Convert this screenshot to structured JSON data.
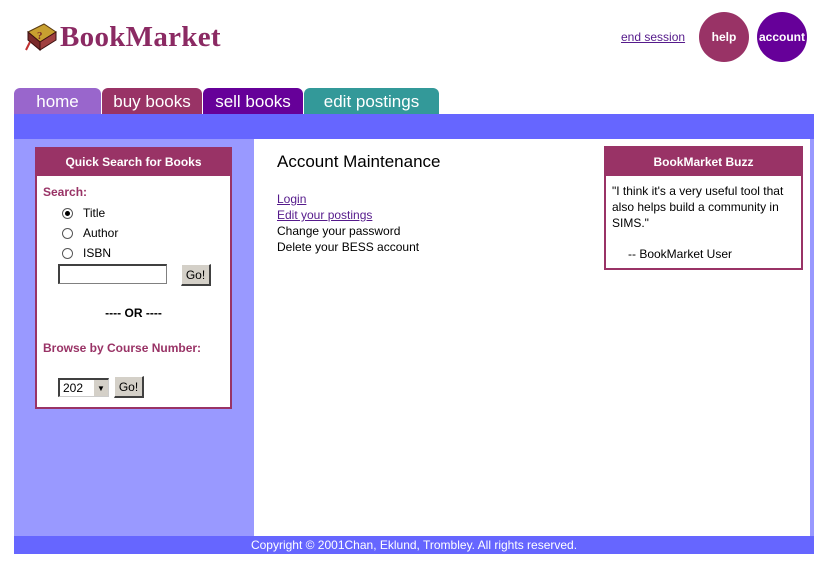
{
  "header": {
    "logo_text": "BookMarket",
    "logo_icon": "book-icon",
    "end_session": "end session",
    "help": "help",
    "account": "account"
  },
  "tabs": [
    {
      "label": "home",
      "color": "#9966cc"
    },
    {
      "label": "buy books",
      "color": "#993366"
    },
    {
      "label": "sell books",
      "color": "#660099"
    },
    {
      "label": "edit postings",
      "color": "#339999"
    }
  ],
  "quick_search": {
    "title": "Quick Search for Books",
    "search_label": "Search:",
    "options": [
      {
        "label": "Title",
        "selected": true
      },
      {
        "label": "Author",
        "selected": false
      },
      {
        "label": "ISBN",
        "selected": false
      }
    ],
    "search_value": "",
    "go_label": "Go!",
    "or_text": "---- OR ----",
    "browse_label": "Browse by Course Number:",
    "course_value": "202",
    "browse_go_label": "Go!"
  },
  "main": {
    "title": "Account Maintenance",
    "links": [
      {
        "label": "Login",
        "is_link": true
      },
      {
        "label": "Edit your postings",
        "is_link": true
      },
      {
        "label": "Change your password",
        "is_link": false
      },
      {
        "label": "Delete your BESS account",
        "is_link": false
      }
    ]
  },
  "buzz": {
    "title": "BookMarket Buzz",
    "quote": "\"I think it's a very useful tool that also helps build a community in SIMS.\"",
    "attribution": "-- BookMarket User"
  },
  "footer": {
    "copyright": "Copyright © 2001Chan, Eklund, Trombley. All rights reserved."
  },
  "colors": {
    "brand": "#8b2a63",
    "primary": "#993366",
    "purple": "#660099",
    "teal": "#339999",
    "banner": "#6666ff",
    "sidebar": "#9999ff"
  }
}
